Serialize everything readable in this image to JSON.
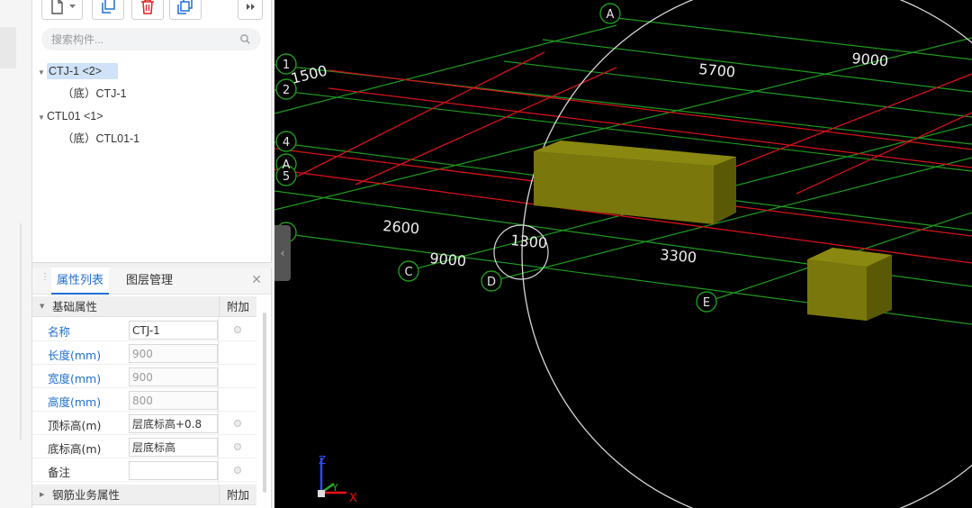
{
  "component_tree": {
    "search_placeholder": "搜索构件...",
    "groups": [
      {
        "label": "CTJ-1 <2>",
        "children": [
          "（底）CTJ-1"
        ]
      },
      {
        "label": "CTL01 <1>",
        "children": [
          "（底）CTL01-1"
        ]
      }
    ]
  },
  "properties_panel": {
    "tabs": [
      "属性列表",
      "图层管理"
    ],
    "extra_column": "附加",
    "basic_section": "基础属性",
    "rebar_section": "钢筋业务属性",
    "rows": [
      {
        "name": "名称",
        "value": "CTJ-1"
      },
      {
        "name": "长度(mm)",
        "value": "900"
      },
      {
        "name": "宽度(mm)",
        "value": "900"
      },
      {
        "name": "高度(mm)",
        "value": "800"
      },
      {
        "name": "顶标高(m)",
        "value": "层底标高+0.8"
      },
      {
        "name": "底标高(m)",
        "value": "层底标高"
      },
      {
        "name": "备注",
        "value": ""
      }
    ]
  },
  "viewport": {
    "axis_labels": [
      "A",
      "1",
      "2",
      "4",
      "A",
      "5",
      "C",
      "D",
      "E"
    ],
    "dimensions": [
      "1500",
      "5700",
      "9000",
      "2600",
      "1300",
      "9000",
      "3300"
    ],
    "coordinate_axes": [
      "Z",
      "Y",
      "X"
    ],
    "colors": {
      "background": "#000000",
      "grid_green": "#1f9a1f",
      "grid_red": "#d4121a",
      "component": "#7c7a0c"
    }
  },
  "icons": [
    "new-component-icon",
    "dropdown-icon",
    "copy-icon",
    "delete-icon",
    "copy-to-floor-icon",
    "more-icon",
    "search-icon",
    "close-icon",
    "collapse-icon"
  ]
}
